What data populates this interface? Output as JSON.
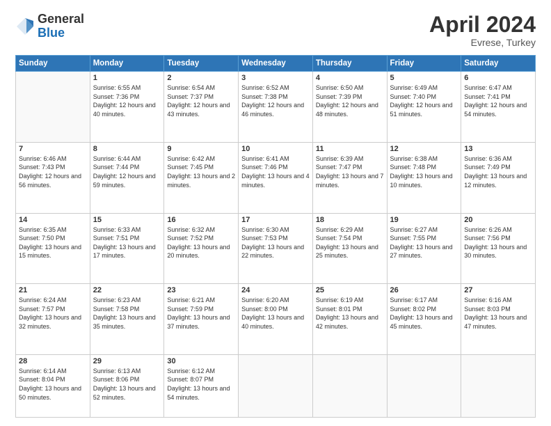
{
  "header": {
    "logo_general": "General",
    "logo_blue": "Blue",
    "month_title": "April 2024",
    "location": "Evrese, Turkey"
  },
  "weekdays": [
    "Sunday",
    "Monday",
    "Tuesday",
    "Wednesday",
    "Thursday",
    "Friday",
    "Saturday"
  ],
  "weeks": [
    [
      {
        "day": "",
        "sunrise": "",
        "sunset": "",
        "daylight": ""
      },
      {
        "day": "1",
        "sunrise": "Sunrise: 6:55 AM",
        "sunset": "Sunset: 7:36 PM",
        "daylight": "Daylight: 12 hours and 40 minutes."
      },
      {
        "day": "2",
        "sunrise": "Sunrise: 6:54 AM",
        "sunset": "Sunset: 7:37 PM",
        "daylight": "Daylight: 12 hours and 43 minutes."
      },
      {
        "day": "3",
        "sunrise": "Sunrise: 6:52 AM",
        "sunset": "Sunset: 7:38 PM",
        "daylight": "Daylight: 12 hours and 46 minutes."
      },
      {
        "day": "4",
        "sunrise": "Sunrise: 6:50 AM",
        "sunset": "Sunset: 7:39 PM",
        "daylight": "Daylight: 12 hours and 48 minutes."
      },
      {
        "day": "5",
        "sunrise": "Sunrise: 6:49 AM",
        "sunset": "Sunset: 7:40 PM",
        "daylight": "Daylight: 12 hours and 51 minutes."
      },
      {
        "day": "6",
        "sunrise": "Sunrise: 6:47 AM",
        "sunset": "Sunset: 7:41 PM",
        "daylight": "Daylight: 12 hours and 54 minutes."
      }
    ],
    [
      {
        "day": "7",
        "sunrise": "Sunrise: 6:46 AM",
        "sunset": "Sunset: 7:43 PM",
        "daylight": "Daylight: 12 hours and 56 minutes."
      },
      {
        "day": "8",
        "sunrise": "Sunrise: 6:44 AM",
        "sunset": "Sunset: 7:44 PM",
        "daylight": "Daylight: 12 hours and 59 minutes."
      },
      {
        "day": "9",
        "sunrise": "Sunrise: 6:42 AM",
        "sunset": "Sunset: 7:45 PM",
        "daylight": "Daylight: 13 hours and 2 minutes."
      },
      {
        "day": "10",
        "sunrise": "Sunrise: 6:41 AM",
        "sunset": "Sunset: 7:46 PM",
        "daylight": "Daylight: 13 hours and 4 minutes."
      },
      {
        "day": "11",
        "sunrise": "Sunrise: 6:39 AM",
        "sunset": "Sunset: 7:47 PM",
        "daylight": "Daylight: 13 hours and 7 minutes."
      },
      {
        "day": "12",
        "sunrise": "Sunrise: 6:38 AM",
        "sunset": "Sunset: 7:48 PM",
        "daylight": "Daylight: 13 hours and 10 minutes."
      },
      {
        "day": "13",
        "sunrise": "Sunrise: 6:36 AM",
        "sunset": "Sunset: 7:49 PM",
        "daylight": "Daylight: 13 hours and 12 minutes."
      }
    ],
    [
      {
        "day": "14",
        "sunrise": "Sunrise: 6:35 AM",
        "sunset": "Sunset: 7:50 PM",
        "daylight": "Daylight: 13 hours and 15 minutes."
      },
      {
        "day": "15",
        "sunrise": "Sunrise: 6:33 AM",
        "sunset": "Sunset: 7:51 PM",
        "daylight": "Daylight: 13 hours and 17 minutes."
      },
      {
        "day": "16",
        "sunrise": "Sunrise: 6:32 AM",
        "sunset": "Sunset: 7:52 PM",
        "daylight": "Daylight: 13 hours and 20 minutes."
      },
      {
        "day": "17",
        "sunrise": "Sunrise: 6:30 AM",
        "sunset": "Sunset: 7:53 PM",
        "daylight": "Daylight: 13 hours and 22 minutes."
      },
      {
        "day": "18",
        "sunrise": "Sunrise: 6:29 AM",
        "sunset": "Sunset: 7:54 PM",
        "daylight": "Daylight: 13 hours and 25 minutes."
      },
      {
        "day": "19",
        "sunrise": "Sunrise: 6:27 AM",
        "sunset": "Sunset: 7:55 PM",
        "daylight": "Daylight: 13 hours and 27 minutes."
      },
      {
        "day": "20",
        "sunrise": "Sunrise: 6:26 AM",
        "sunset": "Sunset: 7:56 PM",
        "daylight": "Daylight: 13 hours and 30 minutes."
      }
    ],
    [
      {
        "day": "21",
        "sunrise": "Sunrise: 6:24 AM",
        "sunset": "Sunset: 7:57 PM",
        "daylight": "Daylight: 13 hours and 32 minutes."
      },
      {
        "day": "22",
        "sunrise": "Sunrise: 6:23 AM",
        "sunset": "Sunset: 7:58 PM",
        "daylight": "Daylight: 13 hours and 35 minutes."
      },
      {
        "day": "23",
        "sunrise": "Sunrise: 6:21 AM",
        "sunset": "Sunset: 7:59 PM",
        "daylight": "Daylight: 13 hours and 37 minutes."
      },
      {
        "day": "24",
        "sunrise": "Sunrise: 6:20 AM",
        "sunset": "Sunset: 8:00 PM",
        "daylight": "Daylight: 13 hours and 40 minutes."
      },
      {
        "day": "25",
        "sunrise": "Sunrise: 6:19 AM",
        "sunset": "Sunset: 8:01 PM",
        "daylight": "Daylight: 13 hours and 42 minutes."
      },
      {
        "day": "26",
        "sunrise": "Sunrise: 6:17 AM",
        "sunset": "Sunset: 8:02 PM",
        "daylight": "Daylight: 13 hours and 45 minutes."
      },
      {
        "day": "27",
        "sunrise": "Sunrise: 6:16 AM",
        "sunset": "Sunset: 8:03 PM",
        "daylight": "Daylight: 13 hours and 47 minutes."
      }
    ],
    [
      {
        "day": "28",
        "sunrise": "Sunrise: 6:14 AM",
        "sunset": "Sunset: 8:04 PM",
        "daylight": "Daylight: 13 hours and 50 minutes."
      },
      {
        "day": "29",
        "sunrise": "Sunrise: 6:13 AM",
        "sunset": "Sunset: 8:06 PM",
        "daylight": "Daylight: 13 hours and 52 minutes."
      },
      {
        "day": "30",
        "sunrise": "Sunrise: 6:12 AM",
        "sunset": "Sunset: 8:07 PM",
        "daylight": "Daylight: 13 hours and 54 minutes."
      },
      {
        "day": "",
        "sunrise": "",
        "sunset": "",
        "daylight": ""
      },
      {
        "day": "",
        "sunrise": "",
        "sunset": "",
        "daylight": ""
      },
      {
        "day": "",
        "sunrise": "",
        "sunset": "",
        "daylight": ""
      },
      {
        "day": "",
        "sunrise": "",
        "sunset": "",
        "daylight": ""
      }
    ]
  ]
}
